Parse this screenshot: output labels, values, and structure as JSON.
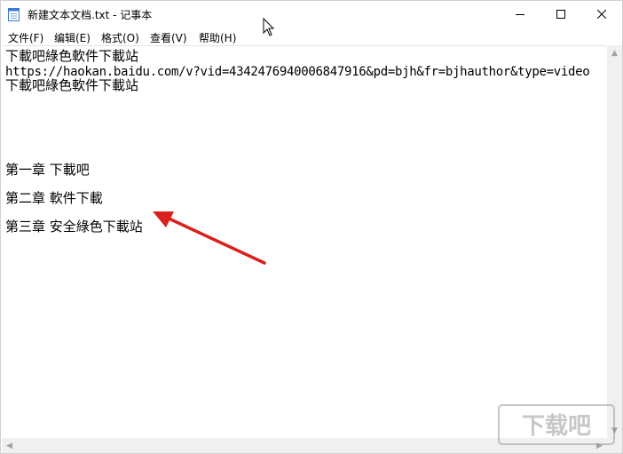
{
  "window": {
    "title": "新建文本文档.txt - 记事本",
    "icons": {
      "app": "notepad-icon",
      "minimize": "minimize-icon",
      "maximize": "maximize-icon",
      "close": "close-icon"
    }
  },
  "menu": {
    "items": [
      {
        "label": "文件(F)"
      },
      {
        "label": "编辑(E)"
      },
      {
        "label": "格式(O)"
      },
      {
        "label": "查看(V)"
      },
      {
        "label": "帮助(H)"
      }
    ]
  },
  "editor": {
    "lines": [
      "下載吧綠色軟件下載站",
      "https://haokan.baidu.com/v?vid=4342476940006847916&pd=bjh&fr=bjhauthor&type=video",
      "下載吧綠色軟件下載站",
      "第一章 下載吧",
      "第二章 軟件下載",
      "第三章 安全綠色下載站"
    ]
  },
  "annotation": {
    "arrow_color": "#d9201f",
    "icon": "red-arrow-annotation"
  },
  "watermark": {
    "text": "下载吧"
  }
}
